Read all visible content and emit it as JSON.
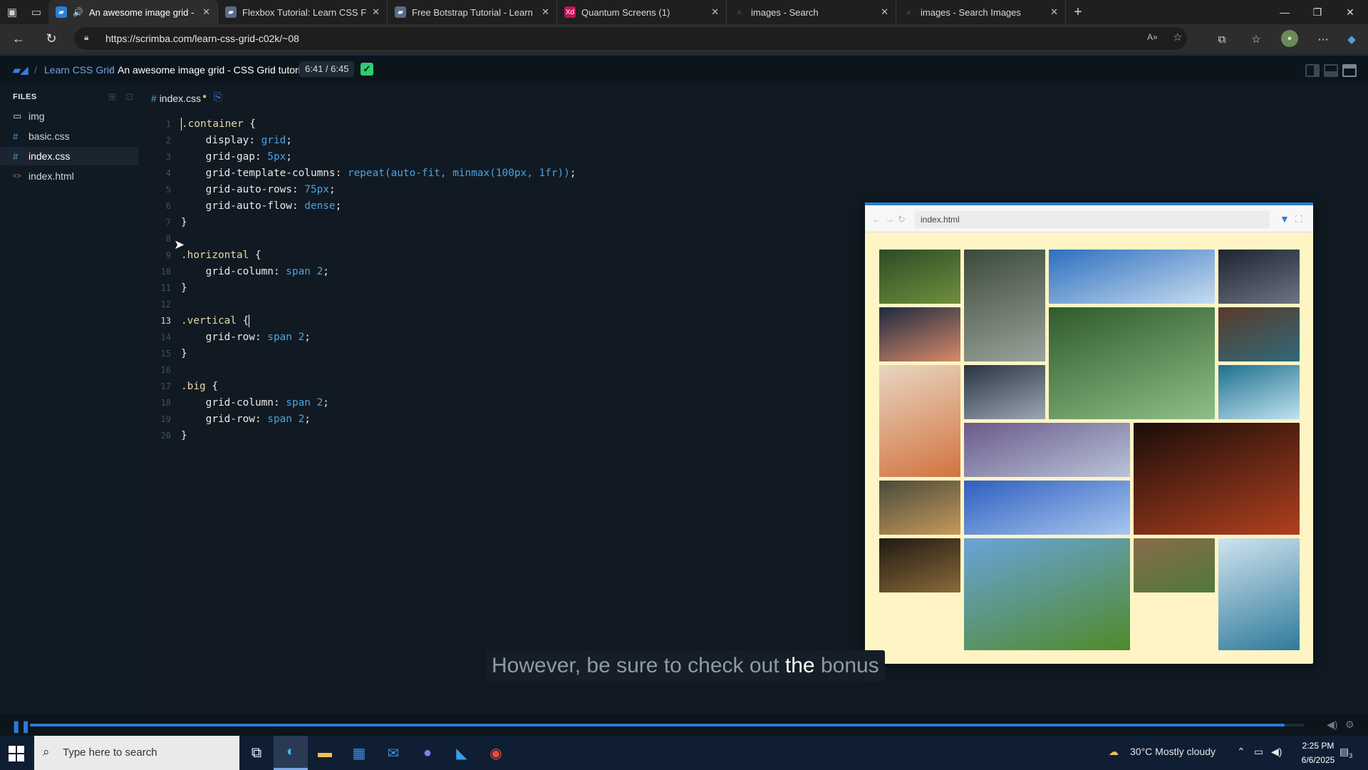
{
  "browser": {
    "tabs": [
      {
        "title": "An awesome image grid - CSS Grid tutorial",
        "active": true
      },
      {
        "title": "Flexbox Tutorial: Learn CSS Flexbox",
        "active": false
      },
      {
        "title": "Free Botstrap Tutorial - Learn Bootstrap",
        "active": false
      },
      {
        "title": "Quantum Screens (1)",
        "active": false
      },
      {
        "title": "images - Search",
        "active": false
      },
      {
        "title": "images - Search Images",
        "active": false
      }
    ],
    "url": "https://scrimba.com/learn-css-grid-c02k/~08"
  },
  "topbar": {
    "course": "Learn CSS Grid",
    "separator": "/",
    "title": "An awesome image grid - CSS Grid tutorial",
    "timer": "6:41 / 6:45"
  },
  "sidebar": {
    "header": "FILES",
    "files": [
      {
        "name": "img",
        "icon": "folder-icon",
        "active": false
      },
      {
        "name": "basic.css",
        "icon": "#",
        "active": false
      },
      {
        "name": "index.css",
        "icon": "#",
        "active": true
      },
      {
        "name": "index.html",
        "icon": "<>",
        "active": false
      }
    ]
  },
  "editor": {
    "tab": "index.css",
    "line_numbers": [
      "1",
      "2",
      "3",
      "4",
      "5",
      "6",
      "7",
      "8",
      "9",
      "10",
      "11",
      "12",
      "13",
      "14",
      "15",
      "16",
      "17",
      "18",
      "19",
      "20"
    ],
    "code": {
      "l1_sel": ".container",
      "l1_brace": " {",
      "l2_prop": "display",
      "l2_val": "grid",
      "l3_prop": "grid-gap",
      "l3_val": "5px",
      "l4_prop": "grid-template-columns",
      "l4_val": "repeat(auto-fit, minmax(100px, 1fr))",
      "l5_prop": "grid-auto-rows",
      "l5_val": "75px",
      "l6_prop": "grid-auto-flow",
      "l6_val": "dense",
      "l7": "}",
      "l9_sel": ".horizontal",
      "l9_brace": " {",
      "l10_prop": "grid-column",
      "l10_val": "span 2",
      "l11": "}",
      "l13_sel": ".vertical",
      "l13_brace": " {",
      "l14_prop": "grid-row",
      "l14_val": "span 2",
      "l15": "}",
      "l17_sel": ".big",
      "l17_brace": " {",
      "l18_prop": "grid-column",
      "l18_val": "span 2",
      "l19_prop": "grid-row",
      "l19_val": "span 2",
      "l20": "}"
    }
  },
  "preview": {
    "url": "index.html",
    "images": [
      {
        "name": "forest-moss",
        "colors": [
          "#2f4a25",
          "#6f8f3d"
        ]
      },
      {
        "name": "waterfall-cliff",
        "colors": [
          "#3b4a3a",
          "#9aa39a"
        ]
      },
      {
        "name": "blue-mountains-aerial",
        "colors": [
          "#2d6fbf",
          "#c7dcef"
        ]
      },
      {
        "name": "dark-sea-rock",
        "colors": [
          "#1d2430",
          "#6d7482"
        ]
      },
      {
        "name": "snowy-peak-sunset",
        "colors": [
          "#1d2a3f",
          "#d98a6a"
        ]
      },
      {
        "name": "waterfall-lagoon",
        "colors": [
          "#2f5a2d",
          "#8fbf86"
        ]
      },
      {
        "name": "red-canyon",
        "colors": [
          "#5a3a2a",
          "#2f6a7a"
        ]
      },
      {
        "name": "desert-road",
        "colors": [
          "#e8d6c2",
          "#d2733f"
        ]
      },
      {
        "name": "boulders-sky",
        "colors": [
          "#2a3440",
          "#9aa7b3"
        ]
      },
      {
        "name": "turquoise-river",
        "colors": [
          "#1f6f8f",
          "#bfe3ef"
        ]
      },
      {
        "name": "purple-mountain-range",
        "colors": [
          "#6a5a8a",
          "#b9c3d9"
        ]
      },
      {
        "name": "night-red-rock",
        "colors": [
          "#1a0d0a",
          "#b0401e"
        ]
      },
      {
        "name": "golden-hills",
        "colors": [
          "#4a4a3a",
          "#c59a5a"
        ]
      },
      {
        "name": "misty-blue-valley",
        "colors": [
          "#2f5fbf",
          "#a7c7ef"
        ]
      },
      {
        "name": "dark-woods-path",
        "colors": [
          "#1f1a12",
          "#8a6a3a"
        ]
      },
      {
        "name": "green-tree-field",
        "colors": [
          "#6aa3d9",
          "#4f8a2a"
        ]
      },
      {
        "name": "plowed-field",
        "colors": [
          "#8a6a4a",
          "#4f7a3a"
        ]
      },
      {
        "name": "mountain-lake",
        "colors": [
          "#cfe3ef",
          "#2f7a9a"
        ]
      }
    ]
  },
  "subtitle": {
    "before": "However, be sure to check out ",
    "highlight": "the",
    "after": " bonus"
  },
  "player": {
    "progress": 0.985
  },
  "taskbar": {
    "search_placeholder": "Type here to search",
    "weather": "30°C  Mostly cloudy",
    "time": "2:25 PM",
    "date": "6/6/2025",
    "notification_count": "3"
  },
  "colors": {
    "accent": "#2a7dd5",
    "selector": "#e8d7a8",
    "value": "#4aa3df",
    "preview_bg": "#fff4c4"
  }
}
